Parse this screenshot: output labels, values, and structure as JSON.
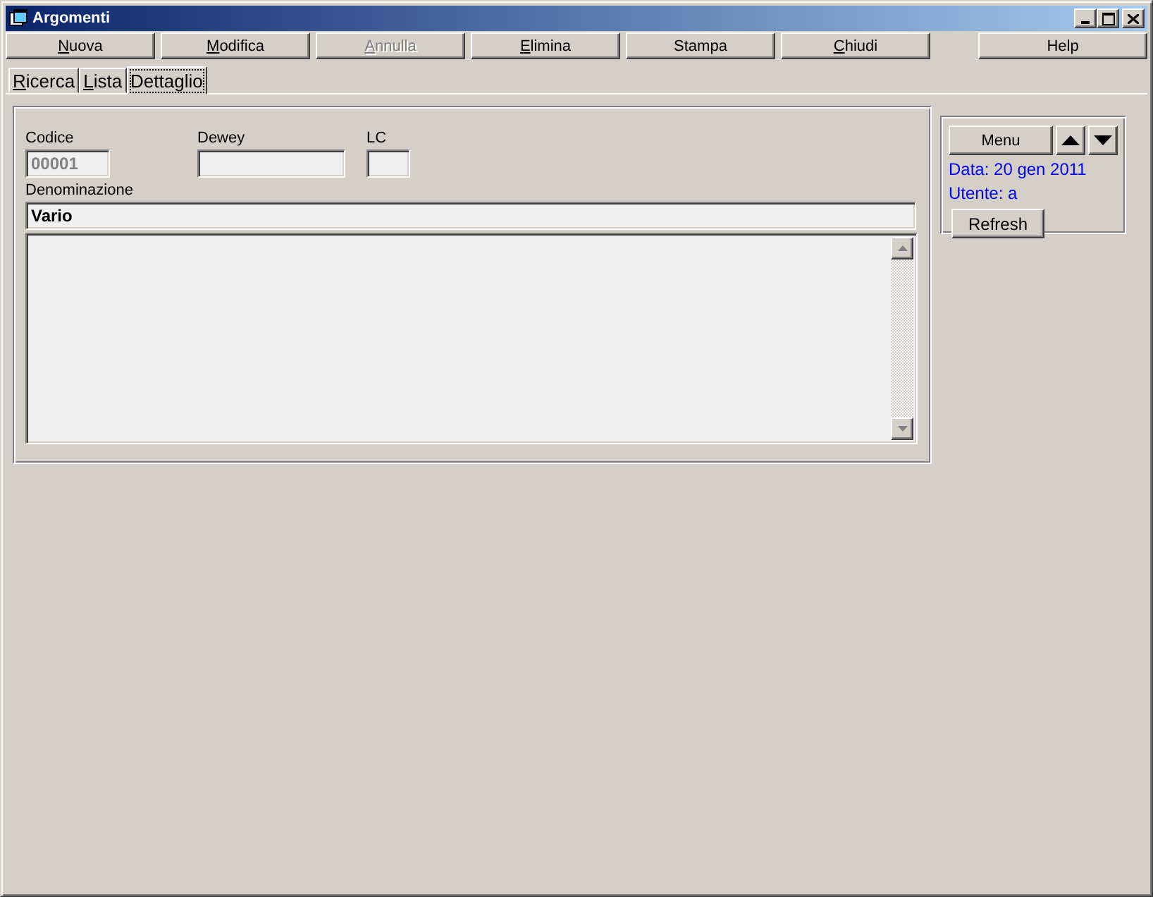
{
  "window": {
    "title": "Argomenti"
  },
  "toolbar": [
    {
      "label": "Nuova",
      "underlined": true,
      "disabled": false
    },
    {
      "label": "Modifica",
      "underlined": true,
      "disabled": false
    },
    {
      "label": "Annulla",
      "underlined": true,
      "disabled": true
    },
    {
      "label": "Elimina",
      "underlined": true,
      "disabled": false
    },
    {
      "label": "Stampa",
      "underlined": false,
      "disabled": false
    },
    {
      "label": "Chiudi",
      "underlined": true,
      "disabled": false
    }
  ],
  "help_button": {
    "label": "Help"
  },
  "tabs": [
    {
      "label": "Ricerca",
      "underlined": true,
      "selected": false
    },
    {
      "label": "Lista",
      "underlined": true,
      "selected": false
    },
    {
      "label": "Dettaglio",
      "underlined": false,
      "selected": true
    }
  ],
  "form": {
    "codice": {
      "label": "Codice",
      "value": "00001",
      "disabled": true
    },
    "dewey": {
      "label": "Dewey"
    },
    "lc": {
      "label": "LC"
    },
    "denominazione": {
      "label": "Denominazione",
      "value": "Vario"
    }
  },
  "side": {
    "menu_button": "Menu",
    "date": "Data: 20 gen 2011",
    "user": "Utente: a",
    "refresh_button": "Refresh"
  }
}
